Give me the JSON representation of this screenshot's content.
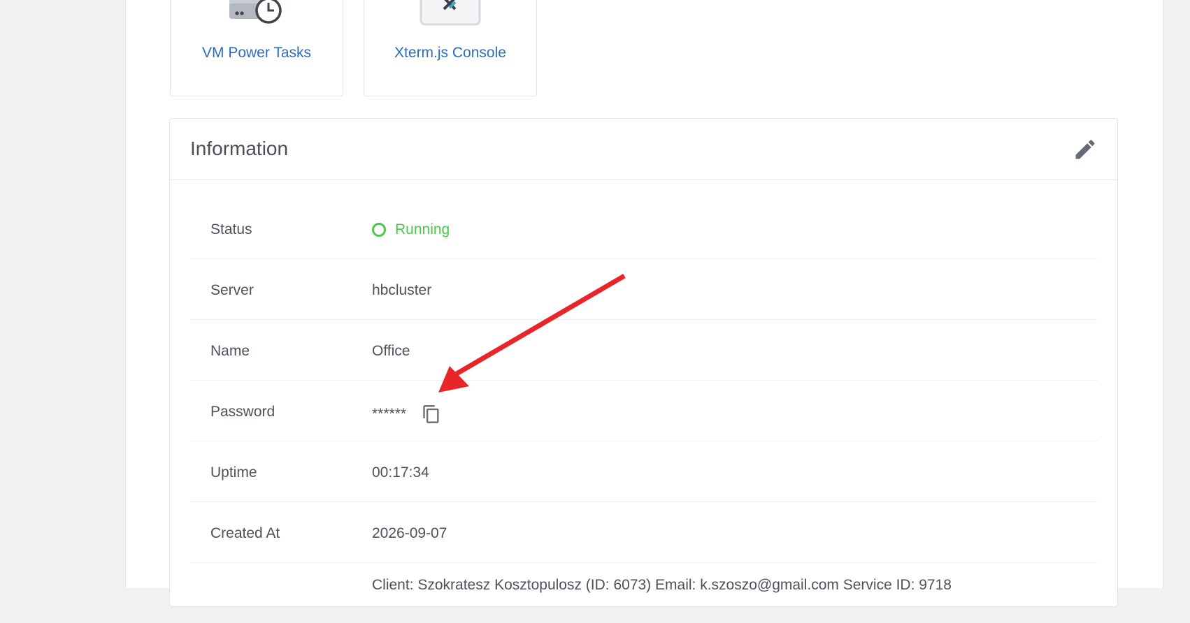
{
  "tiles": [
    {
      "label": "VM Power Tasks",
      "icon": "power-tasks-icon"
    },
    {
      "label": "Xterm.js Console",
      "icon": "xterm-console-icon"
    }
  ],
  "info": {
    "title": "Information",
    "edit_icon": "pencil-icon",
    "rows": {
      "status": {
        "label": "Status",
        "value": "Running",
        "color": "#4cc64c"
      },
      "server": {
        "label": "Server",
        "value": "hbcluster"
      },
      "name": {
        "label": "Name",
        "value": "Office"
      },
      "password": {
        "label": "Password",
        "value": "******",
        "copy_icon": "copy-icon"
      },
      "uptime": {
        "label": "Uptime",
        "value": "00:17:34"
      },
      "created": {
        "label": "Created At",
        "value": "2026-09-07"
      },
      "notes": {
        "value": "Client: Szokratesz Kosztopulosz (ID: 6073) Email: k.szoszo@gmail.com Service ID: 9718"
      }
    }
  },
  "annotation": {
    "color": "#e8262a"
  }
}
